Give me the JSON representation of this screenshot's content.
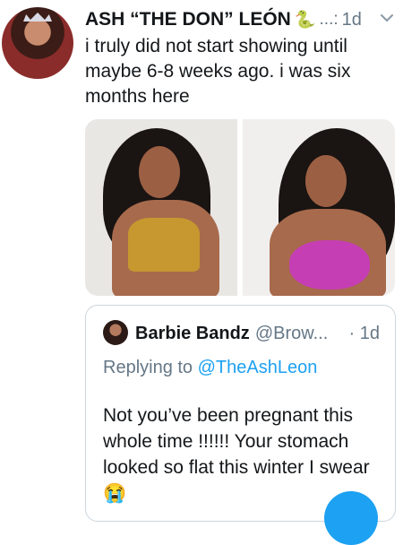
{
  "tweet": {
    "author_name": "ASH “THE DON” LEÓN",
    "name_emoji": "🐍",
    "handle": "...:",
    "time": "1d",
    "text": "i truly did not start showing until maybe 6-8 weeks ago. i was six months here"
  },
  "media": {
    "photos": [
      "photo-1",
      "photo-2"
    ]
  },
  "quoted": {
    "author_name": "Barbie Bandz",
    "handle": "@Brow...",
    "time": "· 1d",
    "replying_prefix": "Replying to",
    "replying_mention": "@TheAshLeon",
    "text": "Not you’ve been pregnant this whole time !!!!!! Your stomach looked so flat this winter I swear 😭"
  },
  "icons": {
    "chevron": "chevron-down-icon"
  },
  "colors": {
    "accent": "#1da1f2",
    "muted": "#657786",
    "border": "#ccd6dd"
  }
}
